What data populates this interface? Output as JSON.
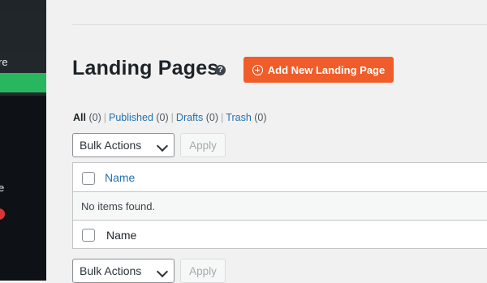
{
  "sidebar": {
    "partial_label_1": "re",
    "partial_label_2": "e"
  },
  "page": {
    "title": "Landing Pages",
    "help_icon": "?",
    "add_button_label": "Add New Landing Page"
  },
  "filters": {
    "all": {
      "label": "All",
      "count": "(0)"
    },
    "published": {
      "label": "Published",
      "count": "(0)"
    },
    "drafts": {
      "label": "Drafts",
      "count": "(0)"
    },
    "trash": {
      "label": "Trash",
      "count": "(0)"
    }
  },
  "bulk_actions_top": {
    "selected": "Bulk Actions",
    "apply_label": "Apply"
  },
  "bulk_actions_bottom": {
    "selected": "Bulk Actions",
    "apply_label": "Apply"
  },
  "table": {
    "header_column": "Name",
    "empty_message": "No items found.",
    "footer_column": "Name"
  },
  "colors": {
    "accent_orange": "#f05d2a",
    "sidebar_active_green": "#28b75f",
    "link_blue": "#2271b1",
    "badge_red": "#d63638"
  },
  "icons": {
    "help": "question-circle-icon",
    "add": "plus-circle-icon",
    "dropdown": "chevron-down-icon"
  }
}
